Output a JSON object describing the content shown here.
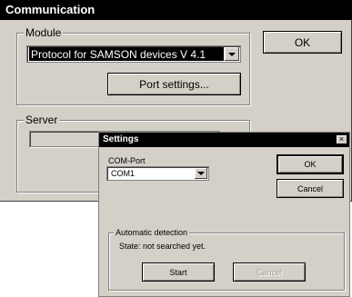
{
  "communication": {
    "title": "Communication",
    "module_label": "Module",
    "module_value": "Protocol for SAMSON devices V 4.1",
    "port_settings_label": "Port settings...",
    "ok_label": "OK",
    "server_label": "Server"
  },
  "settings": {
    "title": "Settings",
    "close_symbol": "×",
    "com_port_label": "COM-Port",
    "com_port_value": "COM1",
    "ok_label": "OK",
    "cancel_label": "Cancel",
    "auto_detection_label": "Automatic detection",
    "state_text": "State: not searched yet.",
    "start_label": "Start",
    "cancel_disabled_label": "Cancel"
  }
}
